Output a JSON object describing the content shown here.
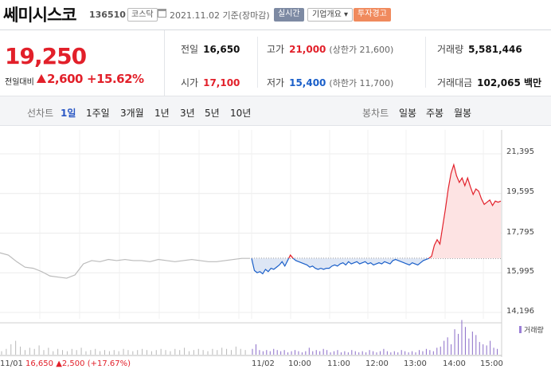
{
  "header": {
    "stock_name": "쎄미시스코",
    "stock_code": "136510",
    "market": "코스닥",
    "date": "2021.11.02 기준(장마감)",
    "realtime_label": "실시간",
    "company_label": "기업개요 ▾",
    "warning_label": "투자경고"
  },
  "price": {
    "current": "19,250",
    "compare_label": "전일대비",
    "change": "2,600",
    "change_pct": "+15.62%",
    "direction": "up"
  },
  "stats": {
    "prev_close_label": "전일",
    "prev_close": "16,650",
    "high_label": "고가",
    "high": "21,000",
    "upper_limit": "(상한가 21,600)",
    "volume_label": "거래량",
    "volume": "5,581,446",
    "open_label": "시가",
    "open": "17,100",
    "low_label": "저가",
    "low": "15,400",
    "lower_limit": "(하한가 11,700)",
    "amount_label": "거래대금",
    "amount": "102,065 백만"
  },
  "tabs": {
    "line_label": "선차트",
    "line_items": [
      "1일",
      "1주일",
      "3개월",
      "1년",
      "3년",
      "5년",
      "10년"
    ],
    "active_line": "1일",
    "candle_label": "봉차트",
    "candle_items": [
      "일봉",
      "주봉",
      "월봉"
    ]
  },
  "chart_data": {
    "type": "line",
    "y_ticks": [
      "21,395",
      "19,595",
      "17,795",
      "15,995",
      "14,196"
    ],
    "ylim": [
      14196,
      21395
    ],
    "x_ticks": [
      "11/02",
      "10:00",
      "11:00",
      "12:00",
      "13:00",
      "14:00",
      "15:00"
    ],
    "baseline": 16650,
    "volume_label": "거래량",
    "prev_day_info": {
      "date": "11/01",
      "price": "16,650",
      "change": "▲2,500 (+17.67%)"
    },
    "colors": {
      "up": "#e2202a",
      "down": "#1a5fc9",
      "prev": "#bbbbbb",
      "volume_prev": "#b8b8b8",
      "volume_today": "#8a6cc8"
    },
    "prev_day": {
      "x": [
        0,
        1,
        2,
        3,
        4,
        5,
        6,
        7,
        8,
        9,
        10,
        11,
        12,
        13,
        14,
        15,
        16,
        17,
        18,
        19,
        20,
        21,
        22,
        23,
        24,
        25,
        26,
        27,
        28,
        29,
        30
      ],
      "values": [
        16900,
        16800,
        16500,
        16250,
        16200,
        16050,
        15850,
        15800,
        15750,
        15900,
        16400,
        16550,
        16500,
        16600,
        16550,
        16600,
        16550,
        16550,
        16500,
        16600,
        16550,
        16500,
        16550,
        16600,
        16550,
        16500,
        16500,
        16550,
        16600,
        16650,
        16650
      ]
    },
    "today": {
      "x": [
        0,
        2,
        4,
        6,
        8,
        10,
        12,
        14,
        16,
        18,
        20,
        22,
        24,
        26,
        28,
        30,
        32,
        34,
        36,
        38,
        40,
        42,
        44,
        46,
        48,
        50,
        52,
        54,
        56,
        58,
        60,
        62,
        64,
        66,
        68,
        70,
        72,
        74,
        76,
        78,
        80,
        82,
        84,
        86,
        88,
        90,
        92,
        94,
        96,
        98,
        100,
        102,
        104,
        106,
        108,
        110,
        112,
        114,
        116,
        118,
        120,
        122,
        124,
        126,
        128,
        130,
        132,
        134,
        136,
        138,
        140,
        142,
        144,
        146,
        148,
        150,
        152,
        154,
        156,
        158,
        160,
        162,
        164,
        166,
        168,
        170,
        172,
        174,
        176,
        178,
        180
      ],
      "values": [
        16650,
        16100,
        16000,
        16050,
        15950,
        16150,
        16050,
        16200,
        16150,
        16250,
        16350,
        16500,
        16300,
        16550,
        16800,
        16650,
        16550,
        16500,
        16450,
        16400,
        16350,
        16250,
        16300,
        16200,
        16150,
        16200,
        16150,
        16200,
        16200,
        16300,
        16350,
        16300,
        16400,
        16450,
        16350,
        16500,
        16400,
        16450,
        16500,
        16400,
        16450,
        16500,
        16400,
        16450,
        16350,
        16400,
        16450,
        16400,
        16500,
        16450,
        16400,
        16550,
        16600,
        16550,
        16500,
        16450,
        16400,
        16350,
        16450,
        16400,
        16350,
        16450,
        16550,
        16600,
        16650,
        16750,
        17250,
        17500,
        17300,
        18100,
        18900,
        19800,
        20500,
        20900,
        20400,
        20100,
        20300,
        19950,
        20300,
        19900,
        19550,
        19800,
        19700,
        19350,
        19100,
        19200,
        19300,
        19050,
        19250,
        19200,
        19250
      ]
    },
    "volume_prev": [
      3,
      5,
      9,
      12,
      7,
      4,
      6,
      5,
      8,
      4,
      6,
      3,
      5,
      4,
      3,
      5,
      4,
      6,
      3,
      4,
      5,
      3,
      4,
      3,
      4,
      3,
      5,
      4,
      3,
      4,
      5,
      4,
      3,
      4,
      5,
      4,
      3,
      5,
      4,
      6,
      3,
      4,
      5,
      4,
      3,
      5,
      4,
      6,
      5,
      4,
      7,
      5,
      4
    ],
    "volume_today": [
      5,
      9,
      4,
      3,
      4,
      3,
      5,
      4,
      3,
      4,
      2,
      3,
      4,
      3,
      2,
      3,
      6,
      3,
      4,
      3,
      5,
      4,
      2,
      3,
      4,
      2,
      3,
      2,
      4,
      3,
      2,
      3,
      2,
      4,
      3,
      2,
      3,
      5,
      3,
      2,
      3,
      2,
      4,
      3,
      2,
      3,
      2,
      4,
      3,
      5,
      4,
      3,
      6,
      7,
      12,
      15,
      9,
      22,
      18,
      30,
      24,
      14,
      20,
      17,
      11,
      9,
      8,
      12,
      6,
      5
    ]
  }
}
